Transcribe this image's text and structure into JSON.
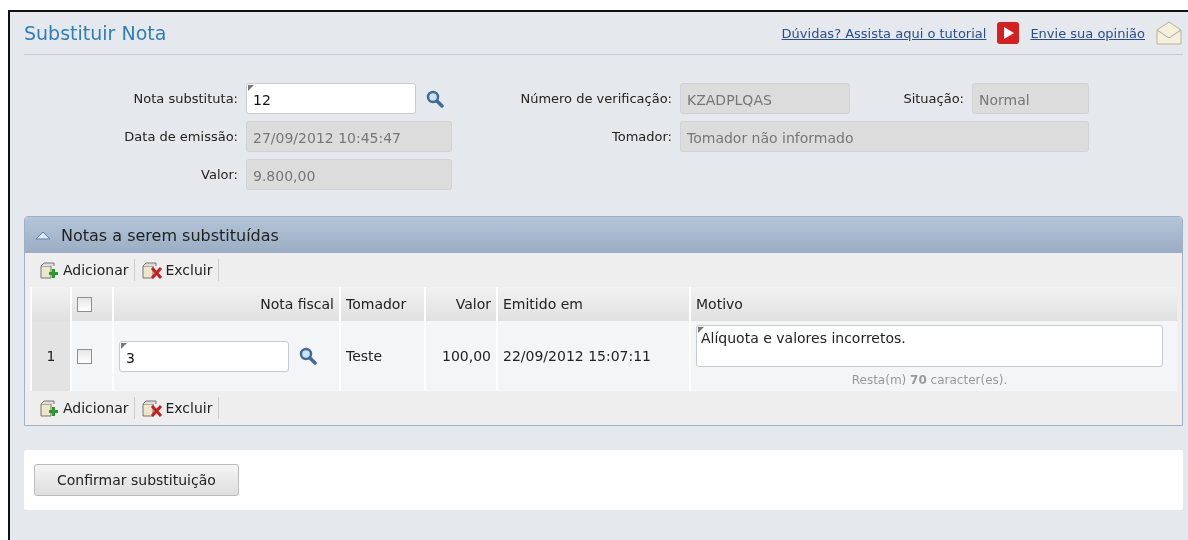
{
  "header": {
    "title": "Substituir Nota",
    "links": [
      {
        "label": "Dúvidas? Assista aqui o tutorial",
        "kind": "video"
      },
      {
        "label": "Envie sua opinião",
        "kind": "mail"
      }
    ]
  },
  "form": {
    "nota_substituta": {
      "label": "Nota substituta:",
      "value": "12"
    },
    "data_emissao": {
      "label": "Data de emissão:",
      "value": "27/09/2012 10:45:47"
    },
    "valor": {
      "label": "Valor:",
      "value": "9.800,00"
    },
    "numero_verificacao": {
      "label": "Número de verificação:",
      "value": "KZADPLQAS"
    },
    "situacao": {
      "label": "Situação:",
      "value": "Normal"
    },
    "tomador": {
      "label": "Tomador:",
      "value": "Tomador não informado"
    }
  },
  "panel": {
    "title": "Notas a serem substituídas",
    "expanded": true,
    "toolbar_top": [
      "Adicionar",
      "Excluir"
    ],
    "columns": [
      "Nota fiscal",
      "Tomador",
      "Valor",
      "Emitido em",
      "Motivo"
    ],
    "header_checked": false,
    "rows": [
      {
        "number": "1",
        "checked": false,
        "nota_fiscal": "3",
        "tomador": "Teste",
        "valor": "100,00",
        "emitido_em": "22/09/2012 15:07:11",
        "motivo": "Alíquota e valores incorretos.",
        "counter": "Resta(m) **70** caracter(es)."
      }
    ],
    "toolbar_bottom": [
      "Adicionar",
      "Excluir"
    ]
  },
  "confirm_button": "Confirmar substituição"
}
